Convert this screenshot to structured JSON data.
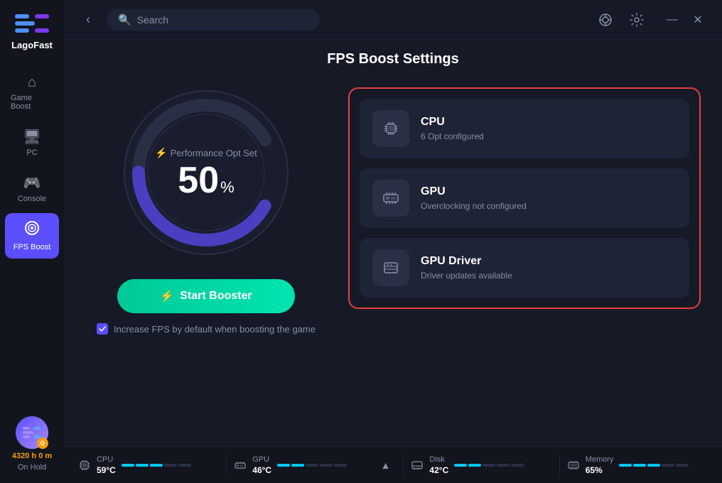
{
  "app": {
    "name": "LagoFast"
  },
  "header": {
    "search_placeholder": "Search",
    "back_label": "←"
  },
  "sidebar": {
    "items": [
      {
        "id": "game-boost",
        "label": "Game Boost",
        "icon": "⌂"
      },
      {
        "id": "pc",
        "label": "PC",
        "icon": "🖥"
      },
      {
        "id": "console",
        "label": "Console",
        "icon": "🎮"
      },
      {
        "id": "fps-boost",
        "label": "FPS Boost",
        "icon": "◎",
        "active": true
      }
    ],
    "user": {
      "hours": "4320",
      "h_label": "h",
      "min": "0",
      "m_label": "m",
      "status": "On Hold"
    }
  },
  "page": {
    "title": "FPS Boost Settings"
  },
  "gauge": {
    "performance_label": "Performance Opt Set",
    "percent": "50",
    "percent_symbol": "%"
  },
  "start_button": {
    "label": "Start Booster",
    "icon": "⚡"
  },
  "checkbox": {
    "label": "Increase FPS by default when boosting the game"
  },
  "cards": [
    {
      "id": "cpu",
      "title": "CPU",
      "subtitle": "6 Opt configured",
      "icon": "⬛"
    },
    {
      "id": "gpu",
      "title": "GPU",
      "subtitle": "Overclocking not configured",
      "icon": "⬛"
    },
    {
      "id": "gpu-driver",
      "title": "GPU Driver",
      "subtitle": "Driver updates available",
      "icon": "⬛"
    }
  ],
  "bottom_bar": {
    "stats": [
      {
        "id": "cpu",
        "label": "CPU",
        "value": "59°C",
        "icon": "⬛",
        "bars": [
          1,
          1,
          1,
          0,
          0
        ]
      },
      {
        "id": "gpu",
        "label": "GPU",
        "value": "46°C",
        "icon": "⬛",
        "bars": [
          1,
          1,
          0,
          0,
          0
        ]
      },
      {
        "id": "disk",
        "label": "Disk",
        "value": "42°C",
        "icon": "⬛",
        "bars": [
          1,
          1,
          0,
          0,
          0
        ]
      },
      {
        "id": "memory",
        "label": "Memory",
        "value": "65%",
        "icon": "⬛",
        "bars": [
          1,
          1,
          1,
          0,
          0
        ]
      }
    ]
  }
}
